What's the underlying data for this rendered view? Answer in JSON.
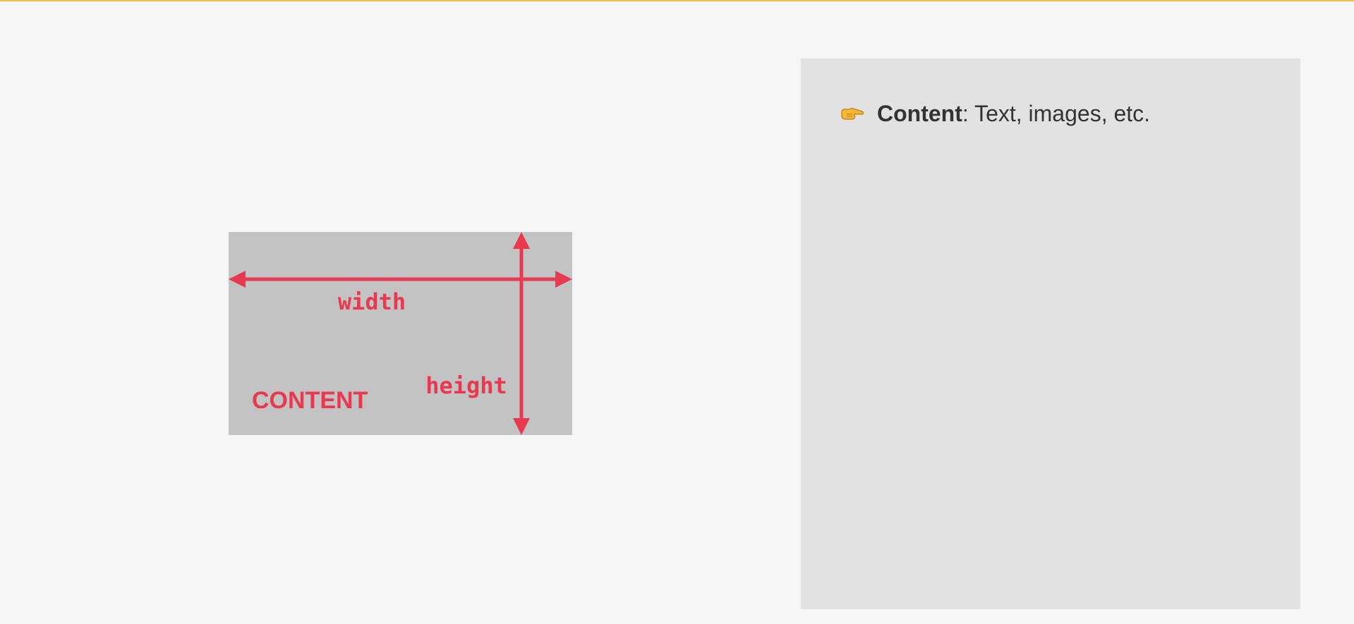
{
  "diagram": {
    "labels": {
      "width": "width",
      "height": "height",
      "content": "CONTENT"
    },
    "colors": {
      "background": "#f6f6f6",
      "box": "#c3c3c3",
      "accent": "#e8394f",
      "top_line": "#f5c04a"
    }
  },
  "note": {
    "icon": "pointing-right-hand-icon",
    "term": "Content",
    "description": ": Text, images, etc.",
    "colors": {
      "panel": "#e2e2e2",
      "text": "#333333"
    }
  }
}
